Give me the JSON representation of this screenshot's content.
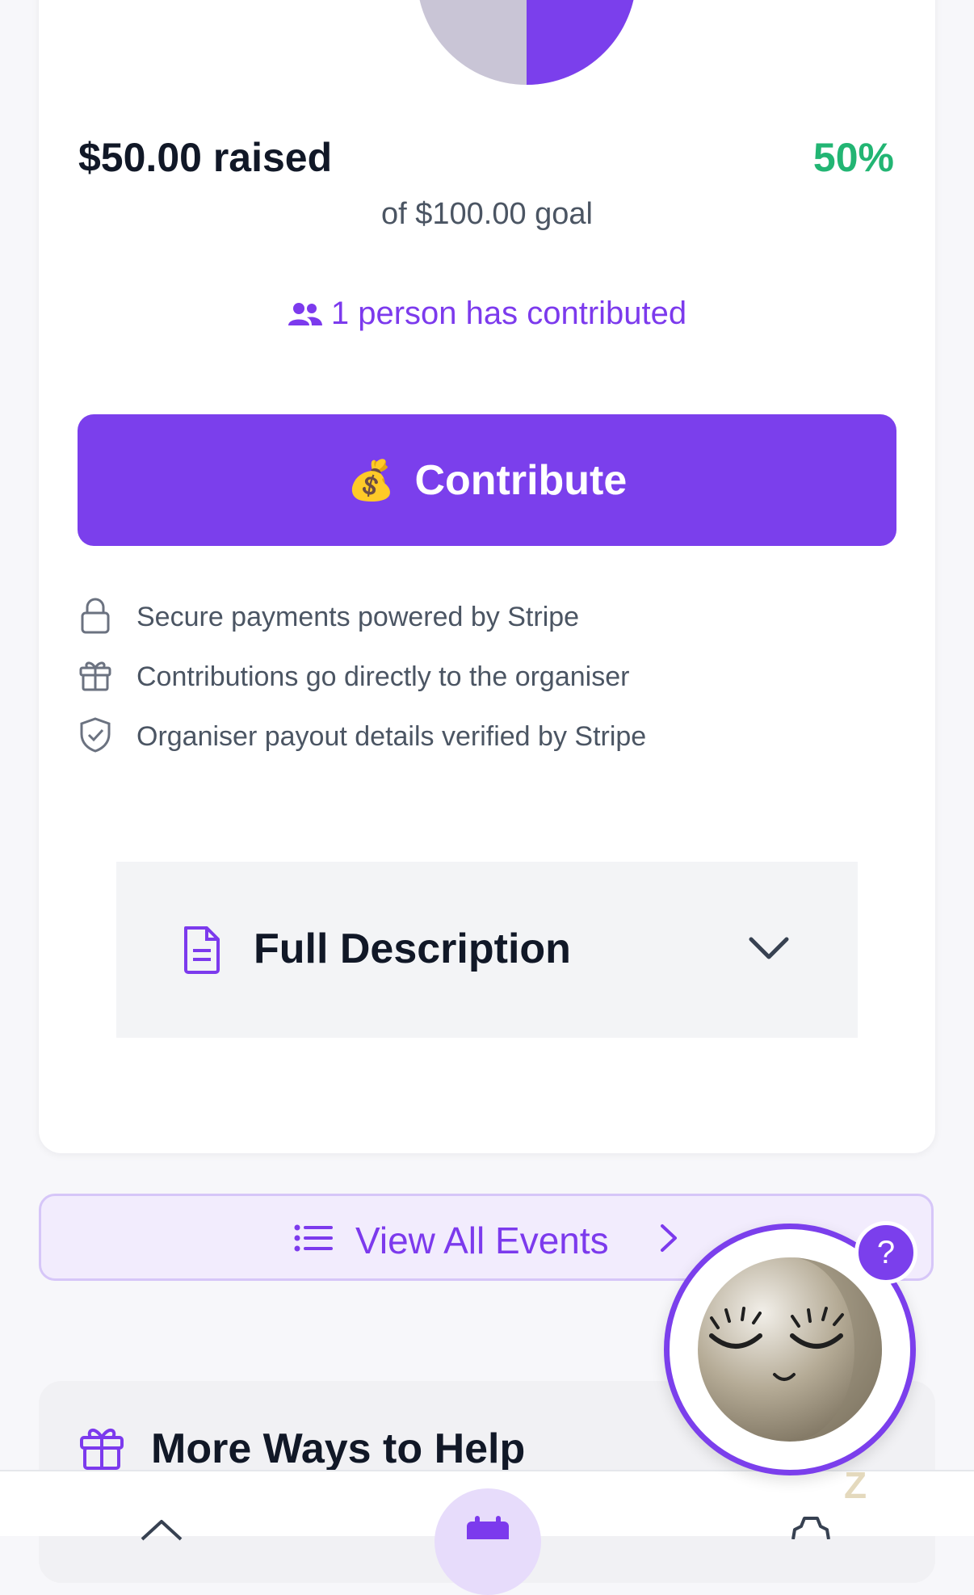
{
  "progress": {
    "raised_label": "$50.00 raised",
    "percent_label": "50%",
    "goal_label": "of $100.00 goal",
    "fraction": 0.5
  },
  "contributors": {
    "label": "1 person has contributed",
    "icon": "users-icon"
  },
  "contribute_button": {
    "emoji": "💰",
    "label": "Contribute"
  },
  "trust_items": [
    {
      "icon": "lock-icon",
      "label": "Secure payments powered by Stripe"
    },
    {
      "icon": "gift-icon",
      "label": "Contributions go directly to the organiser"
    },
    {
      "icon": "shield-check-icon",
      "label": "Organiser payout details verified by Stripe"
    }
  ],
  "full_description": {
    "title": "Full Description",
    "icon": "document-icon"
  },
  "view_all_events": {
    "label": "View All Events",
    "icon": "list-icon"
  },
  "more_ways": {
    "title": "More Ways to Help",
    "icon": "gift-icon"
  },
  "help_badge": "?",
  "sleep_indicator": "Z",
  "colors": {
    "accent": "#7b3fec",
    "success": "#22b573",
    "pie_empty": "#c9c5d6"
  }
}
